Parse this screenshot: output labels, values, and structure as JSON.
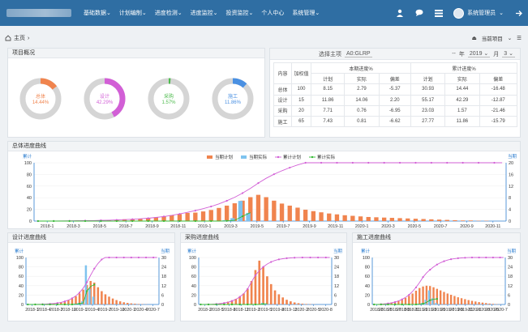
{
  "topbar": {
    "nav": [
      "基础数据",
      "计划编制",
      "进度检测",
      "进度监控",
      "投资监控",
      "个人中心",
      "系统管理"
    ],
    "user": "系统管理员"
  },
  "breadcrumb": {
    "label": "主页"
  },
  "project": {
    "label": "当前项目"
  },
  "overview": {
    "title": "项目概况",
    "donuts": [
      {
        "label": "总体",
        "value": "14.44%",
        "percent": 14.44,
        "color": "#f0844e"
      },
      {
        "label": "设计",
        "value": "42.29%",
        "percent": 42.29,
        "color": "#d25fd6"
      },
      {
        "label": "采购",
        "value": "1.57%",
        "percent": 1.57,
        "color": "#4dbb4d"
      },
      {
        "label": "施工",
        "value": "11.86%",
        "percent": 11.86,
        "color": "#4a90e2"
      }
    ]
  },
  "stats": {
    "select_label": "选择主项",
    "select_value": "A0:GLRP",
    "year_label": "年",
    "year": "2019",
    "month_label": "月",
    "month": "3",
    "header": {
      "content": "内容",
      "weight": "加权值",
      "current": "本期进度%",
      "cumulative": "累计进度%",
      "plan": "计划",
      "actual": "实际",
      "deviation": "偏差"
    },
    "rows": [
      [
        "总体",
        "100",
        "8.15",
        "2.79",
        "-5.37",
        "30.93",
        "14.44",
        "-16.48"
      ],
      [
        "设计",
        "15",
        "11.86",
        "14.06",
        "2.20",
        "55.17",
        "42.29",
        "-12.87"
      ],
      [
        "采购",
        "20",
        "7.71",
        "0.76",
        "-6.95",
        "23.03",
        "1.57",
        "-21.46"
      ],
      [
        "施工",
        "65",
        "7.43",
        "0.81",
        "-6.62",
        "27.77",
        "11.86",
        "-15.79"
      ]
    ]
  },
  "charts": [
    {
      "title": "总体进度曲线",
      "left_axis": "累计",
      "right_axis": "当期",
      "legend": [
        "当期计划",
        "当期实际",
        "累计计划",
        "累计实际"
      ],
      "y_left": [
        0,
        20,
        40,
        60,
        80,
        100
      ],
      "y_right": [
        0,
        4,
        8,
        12,
        16,
        20
      ],
      "x_ticks": [
        "2018-1",
        "2018-3",
        "2018-5",
        "2018-7",
        "2018-9",
        "2018-11",
        "2019-1",
        "2019-3",
        "2019-5",
        "2019-7",
        "2019-9",
        "2019-11",
        "2020-1",
        "2020-3",
        "2020-5",
        "2020-7",
        "2020-9",
        "2020-11"
      ]
    },
    {
      "title": "设计进度曲线",
      "left_axis": "累计",
      "right_axis": "当期",
      "y_left": [
        0,
        20,
        40,
        60,
        80,
        100
      ],
      "y_right": [
        0,
        6,
        12,
        18,
        24,
        30
      ],
      "x_ticks": [
        "2018-1",
        "2018-4",
        "2018-7",
        "2018-10",
        "2019-1",
        "2019-4",
        "2019-7",
        "2019-10",
        "2020-1",
        "2020-4",
        "2020-7"
      ]
    },
    {
      "title": "采购进度曲线",
      "left_axis": "累计",
      "right_axis": "当期",
      "y_left": [
        0,
        20,
        40,
        60,
        80,
        100
      ],
      "y_right": [
        0,
        6,
        12,
        18,
        24,
        30
      ],
      "x_ticks": [
        "2018-2",
        "2018-5",
        "2018-8",
        "2018-11",
        "2019-2",
        "2019-5",
        "2019-8",
        "2019-11",
        "2020-2",
        "2020-5",
        "2020-8"
      ]
    },
    {
      "title": "施工进度曲线",
      "left_axis": "累计",
      "right_axis": "当期",
      "y_left": [
        0,
        20,
        40,
        60,
        80,
        100
      ],
      "y_right": [
        0,
        6,
        12,
        18,
        24,
        30
      ],
      "x_ticks": [
        "2018-3",
        "2018-5",
        "2018-7",
        "2018-9",
        "2018-11",
        "2019-1",
        "2019-3",
        "2019-5",
        "2019-7",
        "2019-9",
        "2019-11",
        "2020-1",
        "2020-3",
        "2020-5",
        "2020-7"
      ]
    }
  ],
  "chart_data": [
    {
      "type": "bar",
      "series": [
        {
          "name": "当期计划",
          "values": [
            0,
            0.1,
            0.1,
            0.1,
            0.1,
            0.2,
            0.2,
            0.2,
            0.3,
            0.3,
            0.4,
            0.6,
            0.6,
            0.8,
            1,
            1.3,
            1.6,
            2,
            2.4,
            2.8,
            2.9,
            3.3,
            3.8,
            4.5,
            5.3,
            6.1,
            7,
            8.2,
            9,
            8.2,
            7,
            6,
            5.3,
            4.6,
            3.9,
            3.4,
            3,
            2.6,
            2.3,
            2,
            1.8,
            1.6,
            1.4,
            1.3,
            1.2,
            1.1,
            1,
            0.9,
            0.8,
            0.7,
            0.6,
            0.5,
            0.4,
            0.3,
            0.2,
            0.2,
            0.1,
            0.1,
            0,
            0
          ]
        },
        {
          "name": "当期实际",
          "values": [
            0,
            0,
            0,
            0,
            0,
            0,
            0,
            0,
            0,
            0,
            0,
            0,
            0,
            0,
            0,
            0,
            0,
            0,
            0,
            0,
            0,
            0,
            0,
            0,
            0.3,
            1,
            6.9,
            2.8,
            0,
            0,
            0,
            0,
            0,
            0,
            0,
            0,
            0,
            0,
            0,
            0,
            0,
            0,
            0,
            0,
            0,
            0,
            0,
            0,
            0,
            0,
            0,
            0,
            0,
            0,
            0,
            0,
            0,
            0,
            0,
            0
          ]
        },
        {
          "name": "累计计划",
          "values": [
            0,
            0.1,
            0.2,
            0.3,
            0.4,
            0.5,
            0.7,
            0.9,
            1.2,
            1.5,
            1.9,
            2.5,
            3.1,
            3.9,
            4.9,
            6.2,
            7.8,
            9.8,
            12.2,
            15,
            17.9,
            21.2,
            25,
            29.5,
            34.8,
            40.9,
            47.9,
            56.1,
            65.1,
            73.3,
            80.3,
            86.3,
            91.6,
            96.2,
            100,
            100,
            100,
            100,
            100,
            100,
            100,
            100,
            100,
            100,
            100,
            100,
            100,
            100,
            100,
            100,
            100,
            100,
            100,
            100,
            100,
            100,
            100,
            100,
            100,
            100
          ]
        },
        {
          "name": "累计实际",
          "values": [
            0,
            0,
            0,
            0,
            0,
            0,
            0,
            0,
            0,
            0,
            0,
            0,
            0,
            0,
            0,
            0,
            0,
            0,
            0,
            0,
            0,
            0,
            0,
            0,
            0.3,
            1.3,
            8.2,
            14.44,
            null,
            null,
            null,
            null,
            null,
            null,
            null,
            null,
            null,
            null,
            null,
            null,
            null,
            null,
            null,
            null,
            null,
            null,
            null,
            null,
            null,
            null,
            null,
            null,
            null,
            null,
            null,
            null,
            null,
            null,
            null,
            null
          ]
        }
      ]
    },
    {
      "type": "bar",
      "series": [
        {
          "name": "当期计划",
          "values": [
            0,
            0.1,
            0.1,
            0.2,
            0.2,
            0.3,
            0.5,
            0.7,
            1,
            1.4,
            2,
            2.8,
            3.8,
            5.2,
            7,
            9.5,
            12.5,
            15,
            14,
            11,
            8.5,
            6.5,
            5,
            3.8,
            2.8,
            2,
            1.4,
            1,
            0.7,
            0.5,
            0.3,
            0.2,
            0.1,
            0,
            0,
            0
          ]
        },
        {
          "name": "当期实际",
          "values": [
            0,
            0,
            0,
            0,
            0,
            0,
            0,
            0,
            0,
            0,
            0,
            0,
            0,
            0.5,
            1,
            2,
            25,
            10,
            5,
            0,
            0,
            0,
            0,
            0,
            0,
            0,
            0,
            0,
            0,
            0,
            0,
            0,
            0,
            0,
            0,
            0
          ]
        },
        {
          "name": "累计计划",
          "values": [
            0,
            0.1,
            0.2,
            0.4,
            0.6,
            0.9,
            1.4,
            2.1,
            3.1,
            4.5,
            6.5,
            9.3,
            13.1,
            18.3,
            25.3,
            34.8,
            47.3,
            62.3,
            76.3,
            87.3,
            95.8,
            100,
            100,
            100,
            100,
            100,
            100,
            100,
            100,
            100,
            100,
            100,
            100,
            100,
            100,
            100
          ]
        },
        {
          "name": "累计实际",
          "values": [
            0,
            0,
            0,
            0,
            0,
            0,
            0,
            0,
            0,
            0,
            0,
            0,
            0,
            0.5,
            1.5,
            3.5,
            28.5,
            38.5,
            42.29,
            null,
            null,
            null,
            null,
            null,
            null,
            null,
            null,
            null,
            null,
            null,
            null,
            null,
            null,
            null,
            null,
            null
          ]
        }
      ]
    },
    {
      "type": "bar",
      "series": [
        {
          "name": "当期计划",
          "values": [
            0,
            0.1,
            0.2,
            0.3,
            0.5,
            0.8,
            1.2,
            1.8,
            2.6,
            3.6,
            5,
            7,
            10,
            15,
            22,
            28,
            24,
            18,
            13,
            9,
            6.5,
            4.5,
            3,
            2,
            1.3,
            0.8,
            0.5,
            0.3,
            0.2,
            0.1,
            0,
            0,
            0,
            0
          ]
        },
        {
          "name": "当期实际",
          "values": [
            0,
            0,
            0,
            0,
            0,
            0,
            0,
            0,
            0,
            0,
            0,
            0,
            0,
            0,
            0,
            0,
            1,
            0.5,
            0,
            0,
            0,
            0,
            0,
            0,
            0,
            0,
            0,
            0,
            0,
            0,
            0,
            0,
            0,
            0
          ]
        },
        {
          "name": "累计计划",
          "values": [
            0,
            0.1,
            0.3,
            0.6,
            1.1,
            1.9,
            3.1,
            4.9,
            7.5,
            11.1,
            16.1,
            23.1,
            33.1,
            48.1,
            62,
            72,
            80,
            86,
            90.5,
            93.8,
            96,
            97.5,
            98.5,
            99.2,
            99.6,
            99.8,
            100,
            100,
            100,
            100,
            100,
            100,
            100,
            100
          ]
        },
        {
          "name": "累计实际",
          "values": [
            0,
            0,
            0,
            0,
            0,
            0,
            0,
            0,
            0,
            0,
            0,
            0,
            0,
            0,
            0,
            0,
            1,
            1.57,
            null,
            null,
            null,
            null,
            null,
            null,
            null,
            null,
            null,
            null,
            null,
            null,
            null,
            null,
            null,
            null
          ]
        }
      ]
    },
    {
      "type": "bar",
      "series": [
        {
          "name": "当期计划",
          "values": [
            0,
            0.2,
            0.4,
            0.6,
            0.9,
            1.3,
            1.8,
            2.4,
            3.2,
            4.2,
            5.5,
            7,
            8.8,
            10.5,
            11.5,
            12,
            11.8,
            11,
            10,
            9,
            8,
            7,
            6.2,
            5.4,
            4.6,
            4,
            3.4,
            2.8,
            2.3,
            1.9,
            1.5,
            1.2,
            0.9,
            0.6,
            0.4,
            0.2,
            0.1,
            0
          ]
        },
        {
          "name": "当期实际",
          "values": [
            0,
            0,
            0,
            0,
            0,
            0,
            0,
            0,
            0,
            0,
            0,
            0,
            0,
            0.5,
            1,
            3,
            9,
            4,
            1,
            0,
            0,
            0,
            0,
            0,
            0,
            0,
            0,
            0,
            0,
            0,
            0,
            0,
            0,
            0,
            0,
            0,
            0,
            0
          ]
        },
        {
          "name": "累计计划",
          "values": [
            0,
            0.2,
            0.6,
            1.2,
            2.1,
            3.4,
            5.2,
            7.6,
            10.8,
            15,
            20.5,
            27.5,
            36.3,
            46.8,
            58.3,
            67,
            74,
            80,
            85,
            89,
            92,
            94.5,
            96.3,
            97.6,
            98.5,
            99.1,
            99.5,
            99.8,
            100,
            100,
            100,
            100,
            100,
            100,
            100,
            100,
            100,
            100
          ]
        },
        {
          "name": "累计实际",
          "values": [
            0,
            0,
            0,
            0,
            0,
            0,
            0,
            0,
            0,
            0,
            0,
            0,
            0,
            0.5,
            1.5,
            4.5,
            9,
            11,
            11.86,
            null,
            null,
            null,
            null,
            null,
            null,
            null,
            null,
            null,
            null,
            null,
            null,
            null,
            null,
            null,
            null,
            null,
            null,
            null
          ]
        }
      ]
    }
  ]
}
